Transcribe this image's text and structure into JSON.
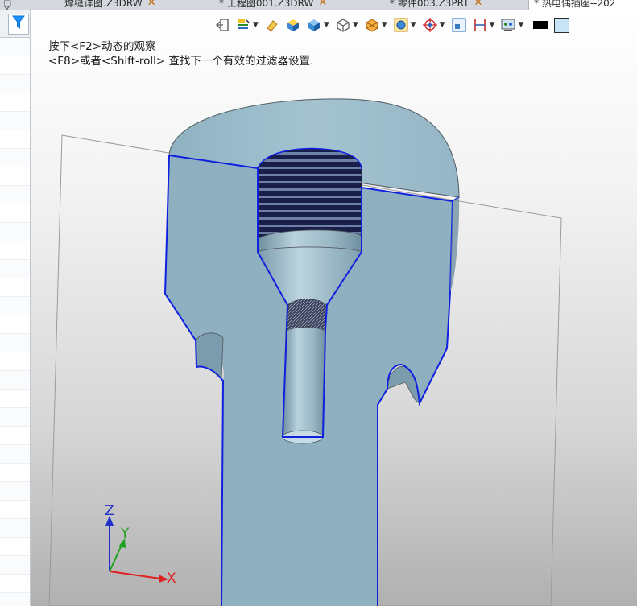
{
  "tabs": [
    {
      "label": "焊缝详图.Z3DRW",
      "close": "✕"
    },
    {
      "label": "* 工程图001.Z3DRW",
      "close": "✕"
    },
    {
      "label": "* 零件003.Z3PRT",
      "close": "✕"
    },
    {
      "label": "* 热电偶插座--202",
      "active": true
    }
  ],
  "tab_controls": "▢ ✕",
  "hint": {
    "line1": "按下<F2>动态的观察",
    "line2": "<F8>或者<Shift-roll> 查找下一个有效的过滤器设置."
  },
  "axes": {
    "z": "Z",
    "y": "Y",
    "x": "X"
  },
  "toolbar": [
    {
      "name": "exit-icon"
    },
    {
      "name": "render-mode-icon",
      "dropdown": true
    },
    {
      "name": "eraser-icon"
    },
    {
      "name": "shaded-box-icon"
    },
    {
      "name": "view-cube-icon",
      "dropdown": true
    },
    {
      "name": "wireframe-cube-icon",
      "dropdown": true
    },
    {
      "name": "section-view-icon",
      "dropdown": true
    },
    {
      "name": "orient-view-icon",
      "dropdown": true
    },
    {
      "name": "target-icon",
      "dropdown": true
    },
    {
      "name": "zoom-fit-icon"
    },
    {
      "name": "dimension-icon",
      "dropdown": true
    },
    {
      "name": "display-filter-icon",
      "dropdown": true
    },
    {
      "name": "black-color-swatch"
    },
    {
      "name": "light-blue-color-swatch"
    }
  ],
  "colors": {
    "part_fill": "#8fb0c0",
    "section_edge": "#1020e0",
    "axis_x": "#e02020",
    "axis_y": "#20a020",
    "axis_z": "#2030c8",
    "filter_icon": "#1e90ff"
  }
}
